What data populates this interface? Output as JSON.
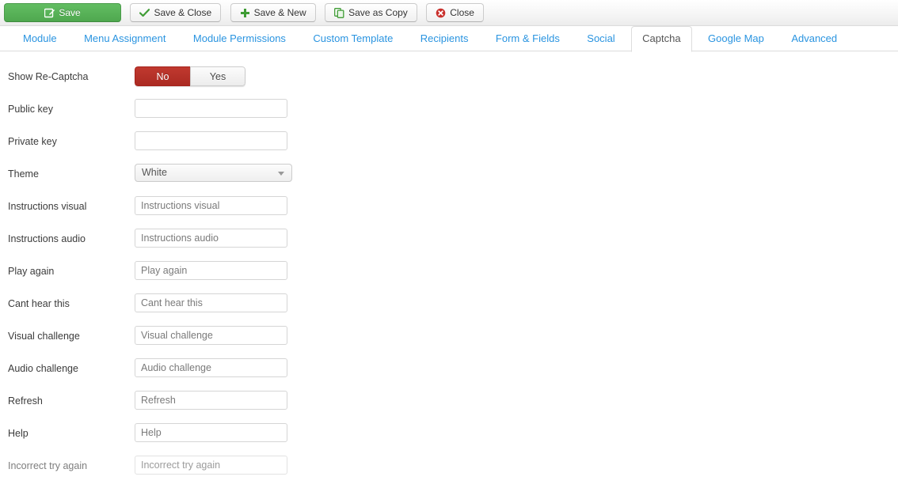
{
  "toolbar": {
    "buttons": [
      {
        "label": "Save",
        "icon": "save-pencil-icon",
        "style": "primary"
      },
      {
        "label": "Save & Close",
        "icon": "check-icon",
        "style": "default"
      },
      {
        "label": "Save & New",
        "icon": "plus-icon",
        "style": "default"
      },
      {
        "label": "Save as Copy",
        "icon": "copy-icon",
        "style": "default"
      },
      {
        "label": "Close",
        "icon": "close-circle-icon",
        "style": "default"
      }
    ]
  },
  "tabs": [
    {
      "label": "Module",
      "active": false
    },
    {
      "label": "Menu Assignment",
      "active": false
    },
    {
      "label": "Module Permissions",
      "active": false
    },
    {
      "label": "Custom Template",
      "active": false
    },
    {
      "label": "Recipients",
      "active": false
    },
    {
      "label": "Form & Fields",
      "active": false
    },
    {
      "label": "Social",
      "active": false
    },
    {
      "label": "Captcha",
      "active": true
    },
    {
      "label": "Google Map",
      "active": false
    },
    {
      "label": "Advanced",
      "active": false
    }
  ],
  "form": {
    "show_recaptcha": {
      "label": "Show Re-Captcha",
      "options": [
        {
          "label": "No",
          "selected": true
        },
        {
          "label": "Yes",
          "selected": false
        }
      ]
    },
    "fields": [
      {
        "label": "Public key",
        "value": "",
        "placeholder": "",
        "type": "text"
      },
      {
        "label": "Private key",
        "value": "",
        "placeholder": "",
        "type": "text"
      },
      {
        "label": "Theme",
        "value": "White",
        "type": "select"
      },
      {
        "label": "Instructions visual",
        "value": "",
        "placeholder": "Instructions visual",
        "type": "text"
      },
      {
        "label": "Instructions audio",
        "value": "",
        "placeholder": "Instructions audio",
        "type": "text"
      },
      {
        "label": "Play again",
        "value": "",
        "placeholder": "Play again",
        "type": "text"
      },
      {
        "label": "Cant hear this",
        "value": "",
        "placeholder": "Cant hear this",
        "type": "text"
      },
      {
        "label": "Visual challenge",
        "value": "",
        "placeholder": "Visual challenge",
        "type": "text"
      },
      {
        "label": "Audio challenge",
        "value": "",
        "placeholder": "Audio challenge",
        "type": "text"
      },
      {
        "label": "Refresh",
        "value": "",
        "placeholder": "Refresh",
        "type": "text"
      },
      {
        "label": "Help",
        "value": "",
        "placeholder": "Help",
        "type": "text"
      },
      {
        "label": "Incorrect try again",
        "value": "",
        "placeholder": "Incorrect try again",
        "type": "text"
      }
    ]
  },
  "colors": {
    "primary_green": "#4fa84f",
    "danger_red": "#ab2a22",
    "link_blue": "#2a94e0",
    "border_grey": "#dddddd"
  }
}
